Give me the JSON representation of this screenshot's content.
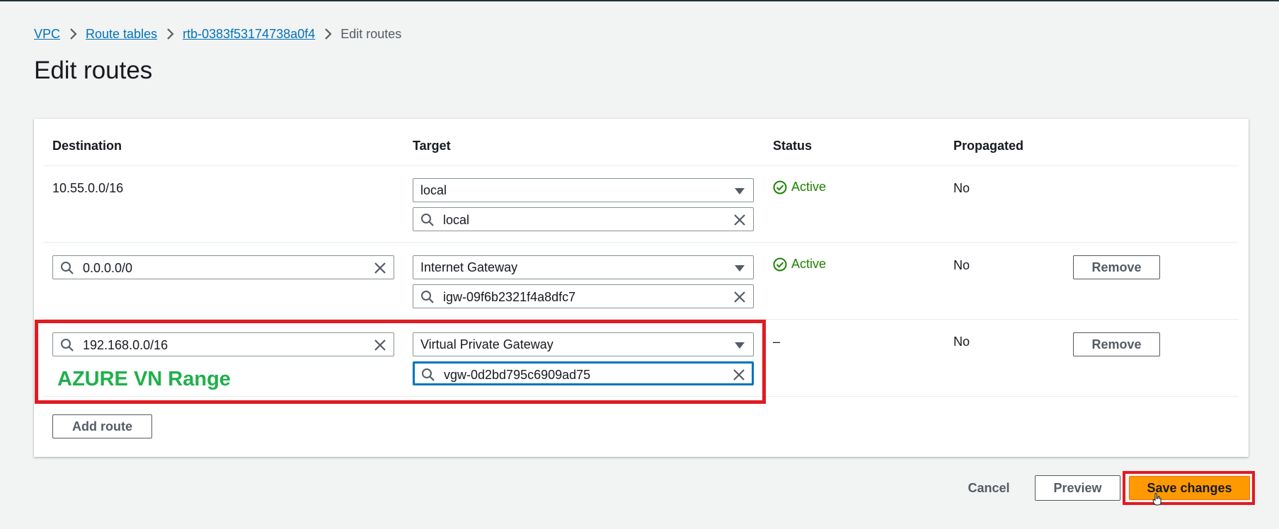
{
  "breadcrumb": {
    "vpc": "VPC",
    "route_tables": "Route tables",
    "route_table_id": "rtb-0383f53174738a0f4",
    "current": "Edit routes"
  },
  "page_title": "Edit routes",
  "table": {
    "headers": {
      "destination": "Destination",
      "target": "Target",
      "status": "Status",
      "propagated": "Propagated"
    },
    "rows": [
      {
        "destination": "10.55.0.0/16",
        "target_type": "local",
        "target_value": "local",
        "status": "Active",
        "propagated": "No"
      },
      {
        "destination": "0.0.0.0/0",
        "target_type": "Internet Gateway",
        "target_value": "igw-09f6b2321f4a8dfc7",
        "status": "Active",
        "propagated": "No",
        "remove_label": "Remove"
      },
      {
        "destination": "192.168.0.0/16",
        "target_type": "Virtual Private Gateway",
        "target_value": "vgw-0d2bd795c6909ad75",
        "status": "–",
        "propagated": "No",
        "remove_label": "Remove"
      }
    ],
    "add_route_label": "Add route"
  },
  "annotation": {
    "label": "AZURE VN Range",
    "label_color": "#1fb04a",
    "box_color": "#e11b22"
  },
  "footer": {
    "cancel_label": "Cancel",
    "preview_label": "Preview",
    "save_label": "Save changes"
  },
  "colors": {
    "link": "#0073bb",
    "active_status": "#1d8102",
    "primary_button": "#ff9900"
  },
  "icons": {
    "breadcrumb_separator": "chevron-right-icon",
    "search": "search-icon",
    "clear": "close-icon",
    "dropdown": "caret-down-icon",
    "status": "check-circle-icon"
  }
}
